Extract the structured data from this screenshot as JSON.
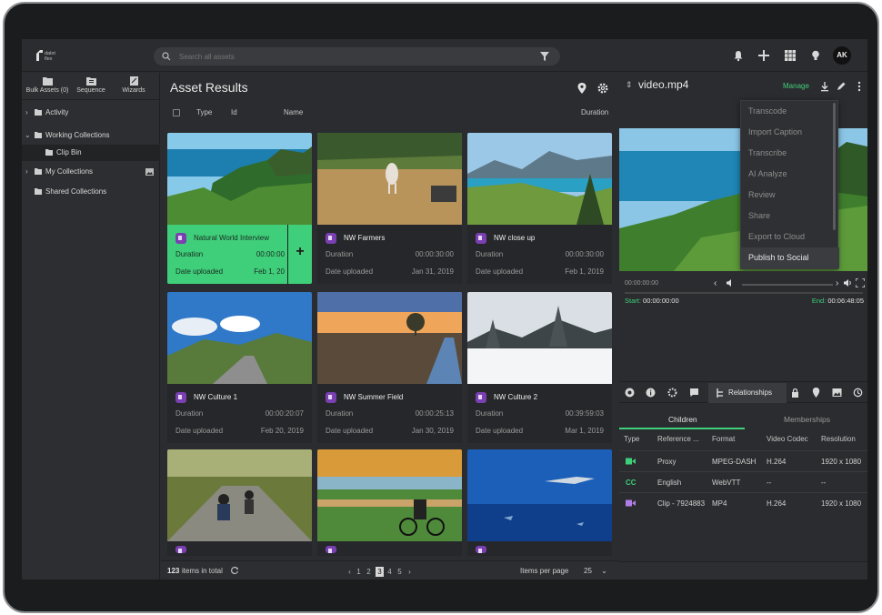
{
  "app": {
    "logo_line1": "dalet",
    "logo_line2": "flex"
  },
  "search": {
    "placeholder": "Search all assets"
  },
  "user": {
    "initials": "AK"
  },
  "sidebar": {
    "tabs": [
      {
        "label": "Bulk Assets (0)",
        "icon": "folder-icon"
      },
      {
        "label": "Sequence",
        "icon": "sequence-icon"
      },
      {
        "label": "Wizards",
        "icon": "wizard-icon"
      }
    ],
    "items": [
      {
        "label": "Activity"
      },
      {
        "label": "Working Collections"
      },
      {
        "label": "Clip Bin"
      },
      {
        "label": "My Collections"
      },
      {
        "label": "Shared Collections"
      }
    ]
  },
  "main": {
    "title": "Asset Results",
    "columns": {
      "type": "Type",
      "id": "Id",
      "name": "Name",
      "duration": "Duration"
    },
    "duration_label": "Duration",
    "uploaded_label": "Date uploaded",
    "cards": [
      {
        "title": "Natural World Interview",
        "duration": "00:00:00",
        "uploaded": "Feb 1, 20",
        "active": true
      },
      {
        "title": "NW Farmers",
        "duration": "00:00:30:00",
        "uploaded": "Jan 31, 2019"
      },
      {
        "title": "NW close up",
        "duration": "00:00:30:00",
        "uploaded": "Feb 1, 2019"
      },
      {
        "title": "NW Culture 1",
        "duration": "00:00:20:07",
        "uploaded": "Feb 20, 2019"
      },
      {
        "title": "NW Summer Field",
        "duration": "00:00:25:13",
        "uploaded": "Jan 30, 2019"
      },
      {
        "title": "NW Culture 2",
        "duration": "00:39:59:03",
        "uploaded": "Mar 1, 2019"
      }
    ],
    "footer": {
      "count": "123",
      "count_suffix": "items in total",
      "pages": [
        "1",
        "2",
        "3",
        "4",
        "5"
      ],
      "current_page": "3",
      "per_page_label": "Items per page",
      "per_page": "25"
    }
  },
  "details": {
    "filename": "video.mp4",
    "manage_label": "Manage",
    "menu": [
      "Transcode",
      "Import Caption",
      "Transcribe",
      "AI Analyze",
      "Review",
      "Share",
      "Export to Cloud",
      "Publish to Social"
    ],
    "player": {
      "timecode": "00:00:00:00",
      "start_label": "Start:",
      "start": "00:00:00:00",
      "end_label": "End:",
      "end": "00:06:48:05"
    },
    "relationships_label": "Relationships",
    "subtabs": {
      "children": "Children",
      "memberships": "Memberships"
    },
    "table": {
      "headers": [
        "Type",
        "Reference ...",
        "Format",
        "Video Codec",
        "Resolution"
      ],
      "rows": [
        {
          "type_icon": "video-icon",
          "reference": "Proxy",
          "format": "MPEG-DASH",
          "codec": "H.264",
          "resolution": "1920 x 1080"
        },
        {
          "type_icon": "CC",
          "reference": "English",
          "format": "WebVTT",
          "codec": "--",
          "resolution": "--"
        },
        {
          "type_icon": "video-icon",
          "reference": "Clip - 7924883",
          "format": "MP4",
          "codec": "H.264",
          "resolution": "1920 x 1080"
        }
      ]
    }
  },
  "colors": {
    "accent": "#3fcf7a",
    "bg": "#2b2c2f",
    "video_badge": "#7a3fb0"
  }
}
